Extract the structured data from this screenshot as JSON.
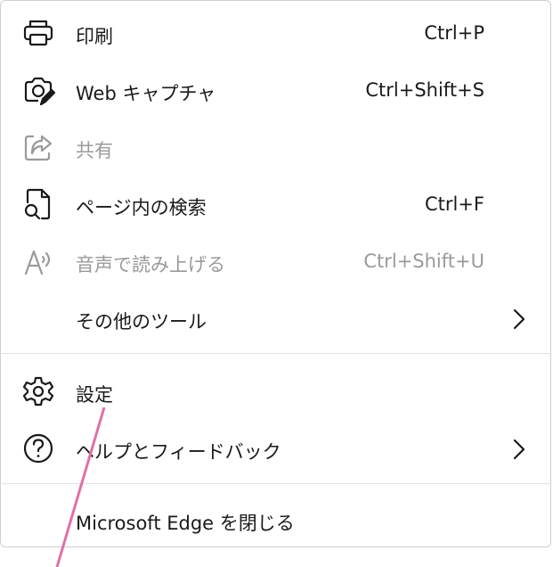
{
  "menu": {
    "items": [
      {
        "label": "印刷",
        "shortcut": "Ctrl+P",
        "icon": "printer-icon",
        "disabled": false
      },
      {
        "label": "Web キャプチャ",
        "shortcut": "Ctrl+Shift+S",
        "icon": "web-capture-icon",
        "disabled": false
      },
      {
        "label": "共有",
        "shortcut": "",
        "icon": "share-icon",
        "disabled": true
      },
      {
        "label": "ページ内の検索",
        "shortcut": "Ctrl+F",
        "icon": "find-on-page-icon",
        "disabled": false
      },
      {
        "label": "音声で読み上げる",
        "shortcut": "Ctrl+Shift+U",
        "icon": "read-aloud-icon",
        "disabled": true
      },
      {
        "label": "その他のツール",
        "shortcut": "",
        "icon": "chevron-right-icon",
        "disabled": false
      },
      {
        "label": "設定",
        "shortcut": "",
        "icon": "gear-icon",
        "disabled": false
      },
      {
        "label": "ヘルプとフィードバック",
        "shortcut": "",
        "icon": "help-icon",
        "disabled": false
      },
      {
        "label": "Microsoft Edge を閉じる",
        "shortcut": "",
        "icon": "",
        "disabled": false
      }
    ]
  },
  "colors": {
    "text": "#1a1a1a",
    "disabled": "#9a9a9a",
    "annotation_line": "#e070a8",
    "divider": "#e1e1e1"
  }
}
